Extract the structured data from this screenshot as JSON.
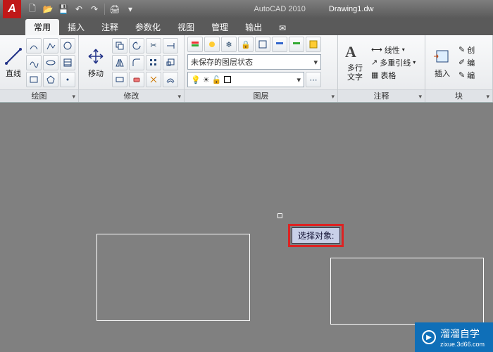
{
  "title": {
    "app": "AutoCAD 2010",
    "doc": "Drawing1.dw"
  },
  "qat": [
    "new",
    "open",
    "save",
    "undo",
    "redo",
    "print",
    "dropdown"
  ],
  "tabs": [
    {
      "label": "常用",
      "active": true
    },
    {
      "label": "插入"
    },
    {
      "label": "注释"
    },
    {
      "label": "参数化"
    },
    {
      "label": "视图"
    },
    {
      "label": "管理"
    },
    {
      "label": "输出"
    },
    {
      "label": "✉"
    }
  ],
  "panels": {
    "draw": {
      "label": "绘图",
      "big": "直线"
    },
    "modify": {
      "label": "修改",
      "big": "移动"
    },
    "layer": {
      "label": "图层",
      "combo": "未保存的图层状态"
    },
    "annot": {
      "label": "注释",
      "big": "多行\n文字",
      "rows": [
        "线性",
        "多重引线",
        "表格"
      ]
    },
    "block": {
      "label": "块",
      "big": "插入",
      "rows": [
        "创",
        "编",
        "编"
      ]
    }
  },
  "canvas": {
    "tooltip": "选择对象:"
  },
  "watermark": {
    "brand": "溜溜自学",
    "url": "zixue.3d66.com"
  }
}
